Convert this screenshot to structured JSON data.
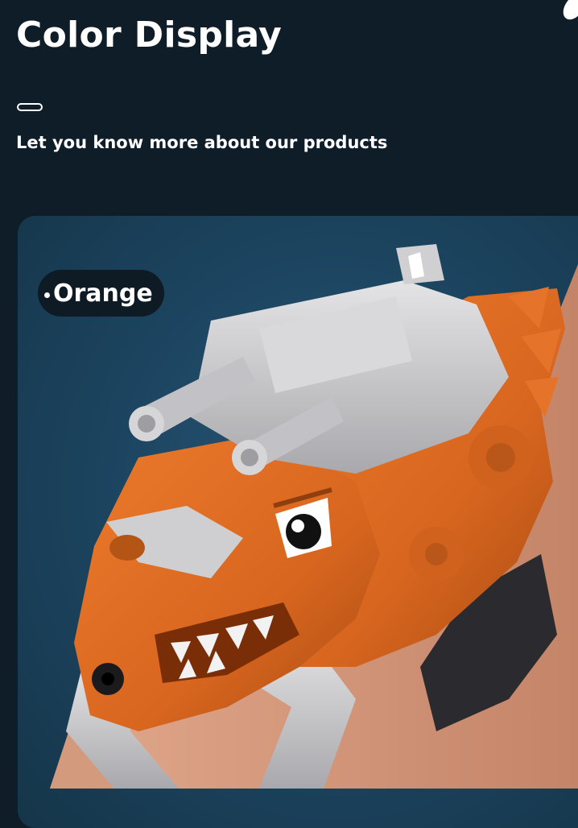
{
  "header": {
    "title": "Color Display",
    "subtitle": "Let you know more about our products"
  },
  "product_card": {
    "color_option": {
      "label": "Orange"
    },
    "image": {
      "subject": "dinosaur-water-gun-wrist-toy",
      "body_color": "#d8661f",
      "accent_color": "#c9c9cc"
    }
  },
  "theme": {
    "page_background": "#0f1d28",
    "card_background": "#1d4662",
    "badge_background": "#0e1a24",
    "text_color": "#ffffff"
  }
}
